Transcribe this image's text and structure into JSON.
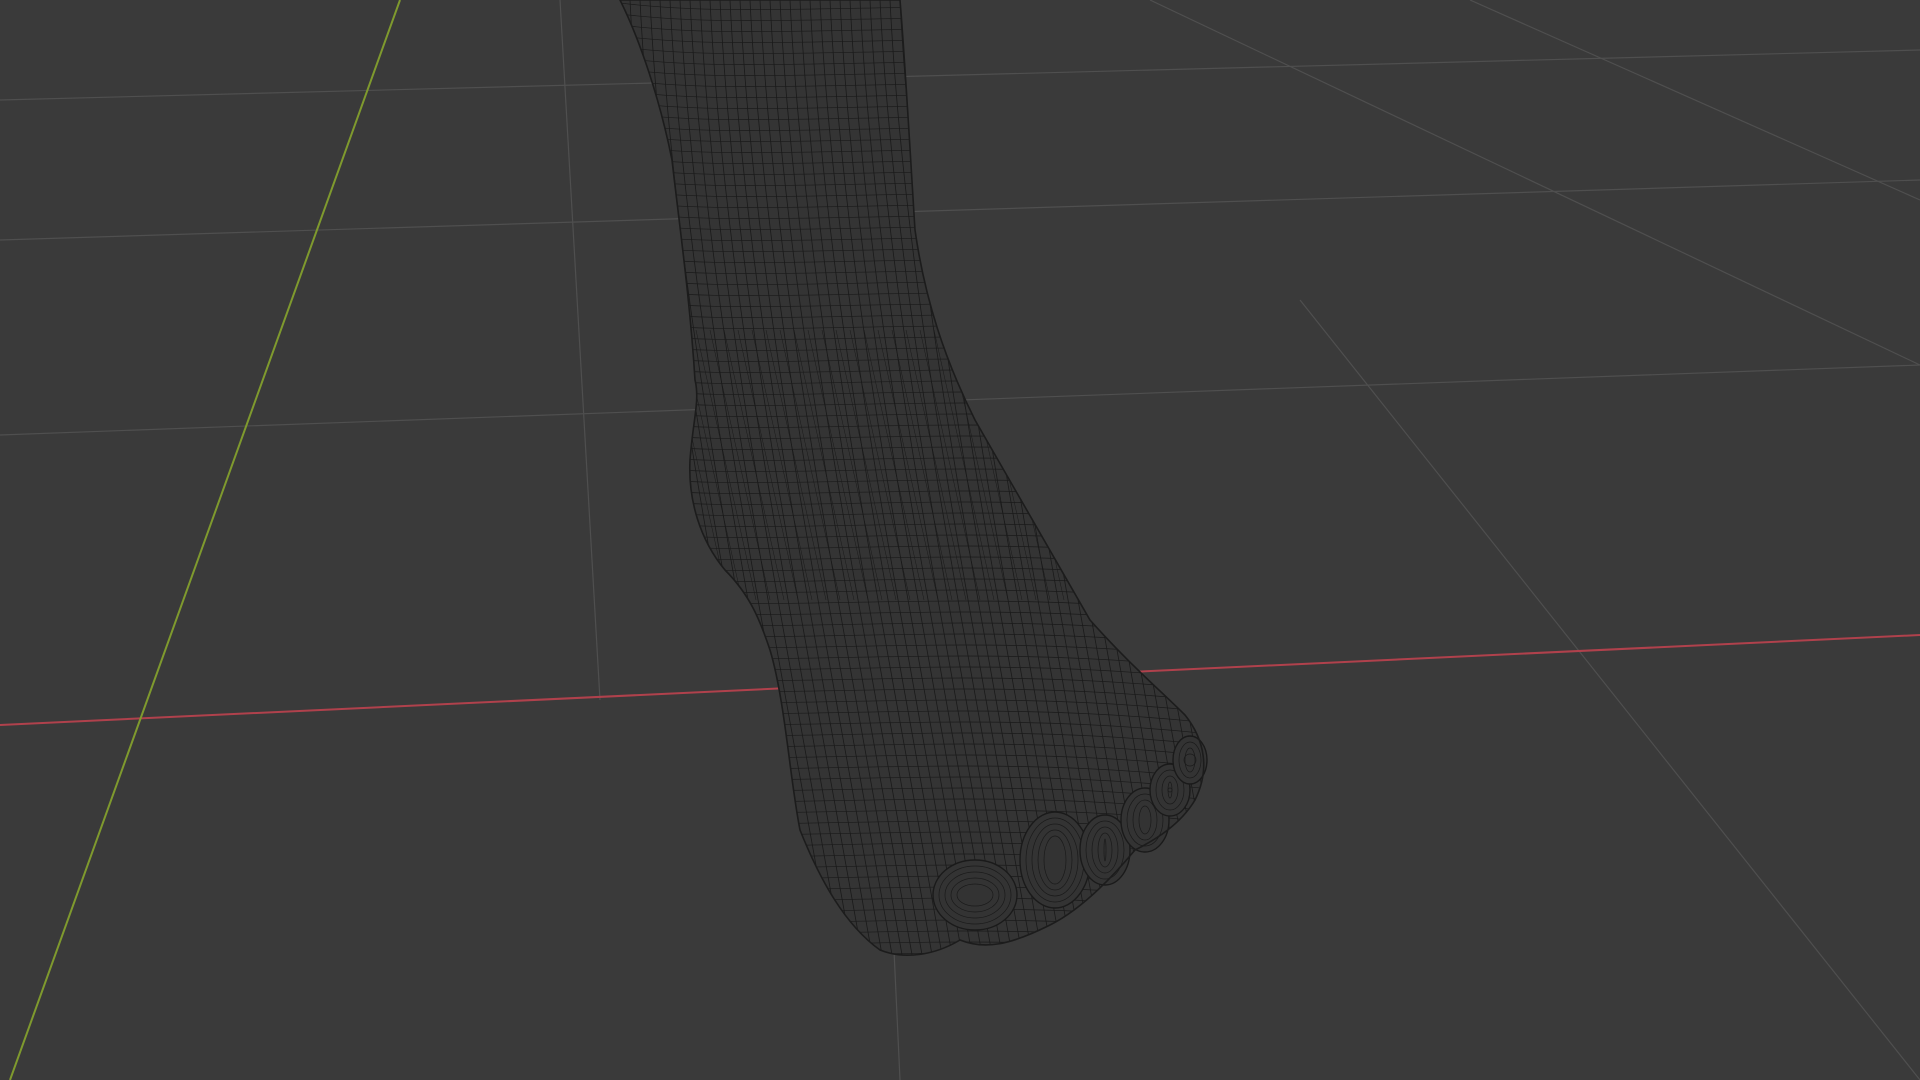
{
  "viewport": {
    "mode": "wireframe",
    "object": "foot-mesh",
    "colors": {
      "background": "#3a3a3a",
      "grid_line": "#4f4f4f",
      "x_axis": "#b0414c",
      "y_axis": "#7f9a2e",
      "wire": "#1a1a1a",
      "wire_fill": "#333333"
    }
  }
}
